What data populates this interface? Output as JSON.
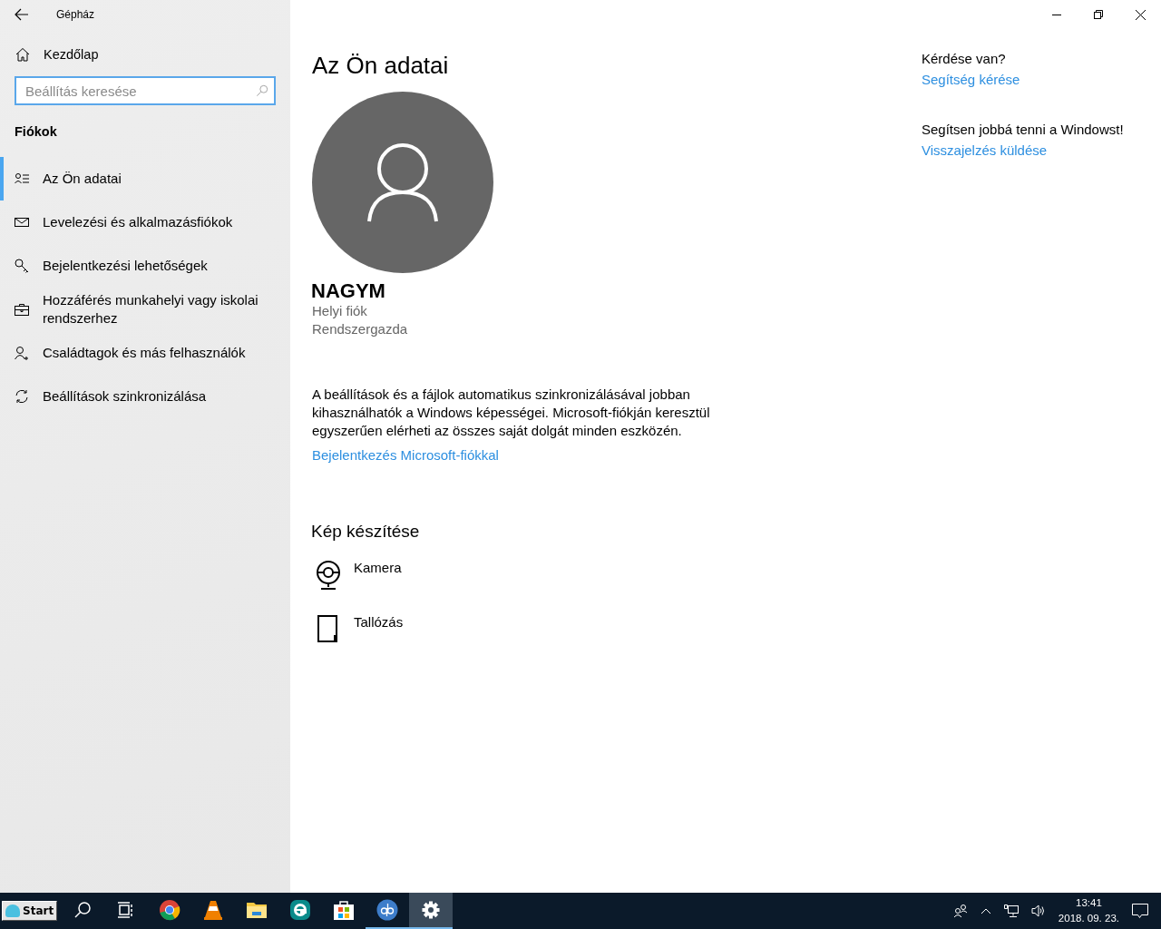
{
  "window": {
    "title": "Gépház"
  },
  "sidebar": {
    "home": "Kezdőlap",
    "search": {
      "placeholder": "Beállítás keresése"
    },
    "section": "Fiókok",
    "items": [
      {
        "label": "Az Ön adatai",
        "kind": "person-list",
        "selected": true
      },
      {
        "label": "Levelezési és alkalmazásfiókok",
        "kind": "mail",
        "selected": false
      },
      {
        "label": "Bejelentkezési lehetőségek",
        "kind": "key",
        "selected": false
      },
      {
        "label": "Hozzáférés munkahelyi vagy iskolai rendszerhez",
        "kind": "briefcase",
        "selected": false
      },
      {
        "label": "Családtagok és más felhasználók",
        "kind": "person-add",
        "selected": false
      },
      {
        "label": "Beállítások szinkronizálása",
        "kind": "sync",
        "selected": false
      }
    ]
  },
  "main": {
    "title": "Az Ön adatai",
    "user": {
      "name": "NAGYM",
      "lines": [
        "Helyi fiók",
        "Rendszergazda"
      ]
    },
    "description": "A beállítások és a fájlok automatikus szinkronizálásával jobban kihasználhatók a Windows képességei. Microsoft-fiókján keresztül egyszerűen elérheti az összes saját dolgát minden eszközén.",
    "link": "Bejelentkezés Microsoft-fiókkal",
    "picture_section": {
      "title": "Kép készítése",
      "options": [
        {
          "label": "Kamera",
          "kind": "camera"
        },
        {
          "label": "Tallózás",
          "kind": "browse"
        }
      ]
    }
  },
  "aside": [
    {
      "heading": "Kérdése van?",
      "link": "Segítség kérése"
    },
    {
      "heading": "Segítsen jobbá tenni a Windowst!",
      "link": "Visszajelzés küldése"
    }
  ],
  "taskbar": {
    "start": "Start",
    "apps": [
      {
        "kind": "search",
        "running": false,
        "selected": false
      },
      {
        "kind": "taskview",
        "running": false,
        "selected": false
      },
      {
        "kind": "chrome",
        "running": false,
        "selected": false
      },
      {
        "kind": "vlc",
        "running": false,
        "selected": false
      },
      {
        "kind": "explorer",
        "running": false,
        "selected": false
      },
      {
        "kind": "eset",
        "running": false,
        "selected": false
      },
      {
        "kind": "store",
        "running": false,
        "selected": false
      },
      {
        "kind": "qbittorrent",
        "running": true,
        "selected": false
      },
      {
        "kind": "settings",
        "running": true,
        "selected": true
      }
    ],
    "time": "13:41",
    "date": "2018. 09. 23."
  }
}
